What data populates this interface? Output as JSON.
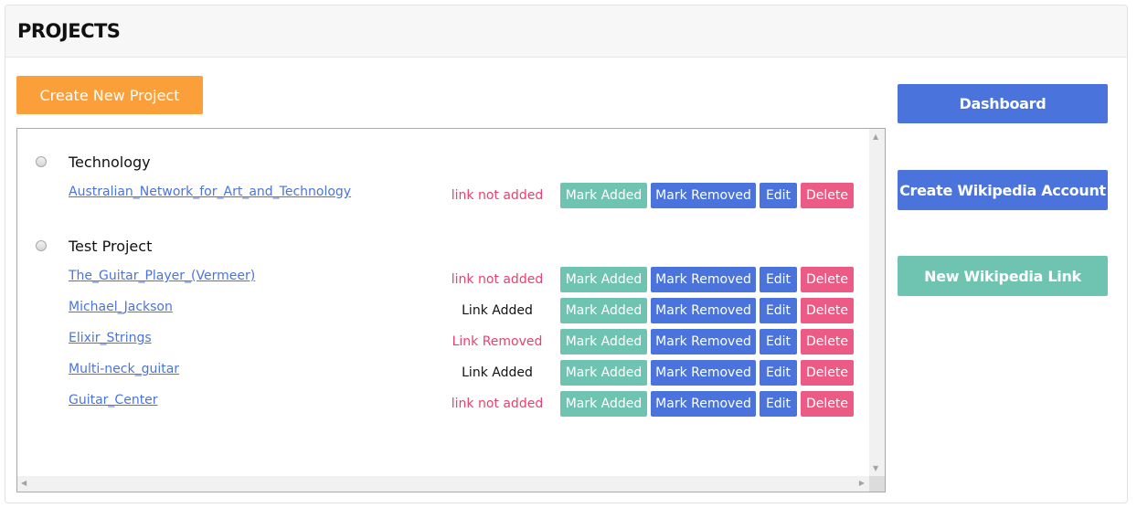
{
  "header": {
    "title": "PROJECTS"
  },
  "actions": {
    "create_project": "Create New Project"
  },
  "sidebar": {
    "dashboard": "Dashboard",
    "create_account": "Create Wikipedia Account",
    "new_link": "New Wikipedia Link"
  },
  "row_actions": {
    "mark_added": "Mark Added",
    "mark_removed": "Mark Removed",
    "edit": "Edit",
    "delete": "Delete"
  },
  "projects": [
    {
      "name": "Technology",
      "links": [
        {
          "title": "Australian_Network_for_Art_and_Technology",
          "status": "link not added",
          "status_color": "#e8416f"
        }
      ]
    },
    {
      "name": "Test Project",
      "links": [
        {
          "title": "The_Guitar_Player_(Vermeer)",
          "status": "link not added",
          "status_color": "#e8416f"
        },
        {
          "title": "Michael_Jackson",
          "status": "Link Added",
          "status_color": "#111111"
        },
        {
          "title": "Elixir_Strings",
          "status": "Link Removed",
          "status_color": "#e8416f"
        },
        {
          "title": "Multi-neck_guitar",
          "status": "Link Added",
          "status_color": "#111111"
        },
        {
          "title": "Guitar_Center",
          "status": "link not added",
          "status_color": "#e8416f"
        }
      ]
    }
  ],
  "colors": {
    "orange": "#fb9f3b",
    "blue": "#4a74dc",
    "teal": "#6fc3b1",
    "pink": "#ec5a86"
  }
}
